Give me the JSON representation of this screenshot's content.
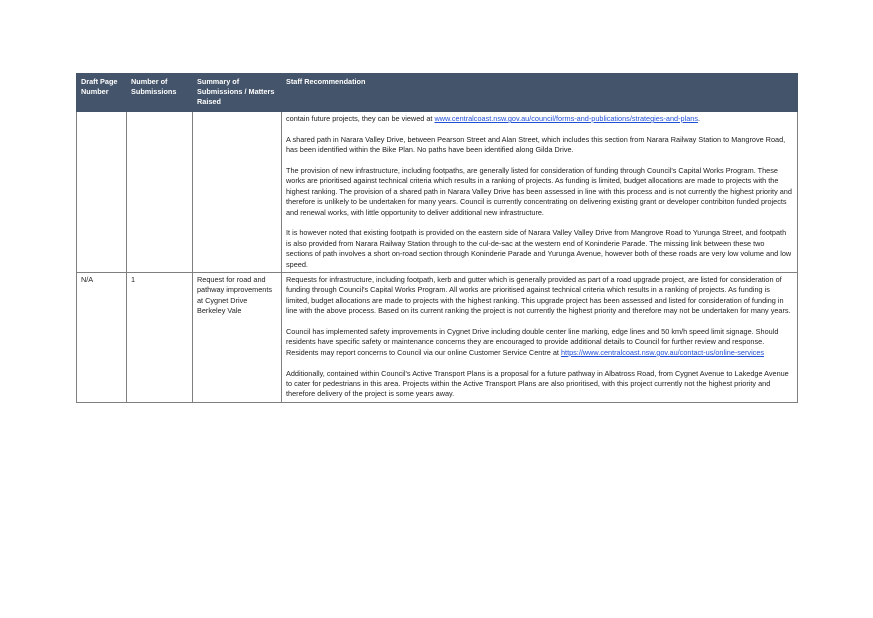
{
  "table": {
    "headers": {
      "page": "Draft Page Number",
      "count": "Number of Submissions",
      "summary": "Summary of Submissions / Matters Raised",
      "recommendation": "Staff Recommendation"
    },
    "rows": [
      {
        "page": "",
        "count": "",
        "summary": "",
        "paragraphs": [
          {
            "text_before": "contain future projects, they can be viewed at ",
            "link": "www.centralcoast.nsw.gov.au/council/forms-and-publications/strategies-and-plans",
            "text_after": "."
          },
          {
            "text": "A shared path in Narara Valley Drive, between Pearson Street and Alan Street, which includes this section from Narara Railway Station to Mangrove Road, has been identified within the Bike Plan. No paths have been identified along Gilda Drive."
          },
          {
            "text": "The provision of new infrastructure, including footpaths, are generally listed for consideration of funding through Council's Capital Works Program. These works are prioritised against technical criteria which results in a ranking of projects.  As funding is limited, budget allocations are made to projects with the highest ranking. The provision of a shared path in Narara Valley Drive has been assessed in line with this process and is not currently the highest priority and therefore is unlikely to be undertaken for many years. Council is currently concentrating on delivering existing grant or developer contribiton funded projects and renewal works, with little opportunity to deliver additional new infrastructure."
          },
          {
            "text": "It is however noted that existing footpath is provided on the eastern side of Narara Valley Valley Drive from Mangrove Road to Yurunga Street, and footpath is also provided from Narara Railway Station through to the cul-de-sac at the western end of Koninderie Parade. The missing link between these two sections of path involves a short on-road section through Koninderie Parade and Yurunga Avenue, however both of these roads are very low volume and low speed."
          }
        ]
      },
      {
        "page": "N/A",
        "count": "1",
        "summary": "Request for road and pathway improvements at Cygnet Drive Berkeley Vale",
        "paragraphs": [
          {
            "text": "Requests for infrastructure, including footpath, kerb and gutter which is generally provided as part of a road upgrade project, are listed for consideration of funding through Council's Capital Works Program. All works are prioritised against technical criteria which results in a ranking of projects. As funding is limited, budget allocations are made to projects with the highest ranking. This upgrade project has been assessed and listed for consideration of funding in line with the above process. Based on its current ranking the project is not currently the highest priority and therefore may not be undertaken for many years."
          },
          {
            "text_before": "Council has implemented safety improvements in Cygnet Drive including double center line marking, edge lines and 50 km/h speed limit signage. Should residents have specific safety or maintenance concerns they are encouraged to provide additional details to Council for further review and response. Residents may report concerns to Council via our online Customer Service Centre at ",
            "link": "https://www.centralcoast.nsw.gov.au/contact-us/online-services",
            "text_after": ""
          },
          {
            "text": "Additionally, contained within Council's Active Transport Plans is a proposal for a future pathway in Albatross Road, from Cygnet Avenue to Lakedge Avenue to cater for pedestrians in this area. Projects within the Active Transport Plans are also prioritised, with this project currently not the highest priority and therefore delivery of the project is some years away."
          }
        ]
      }
    ]
  }
}
